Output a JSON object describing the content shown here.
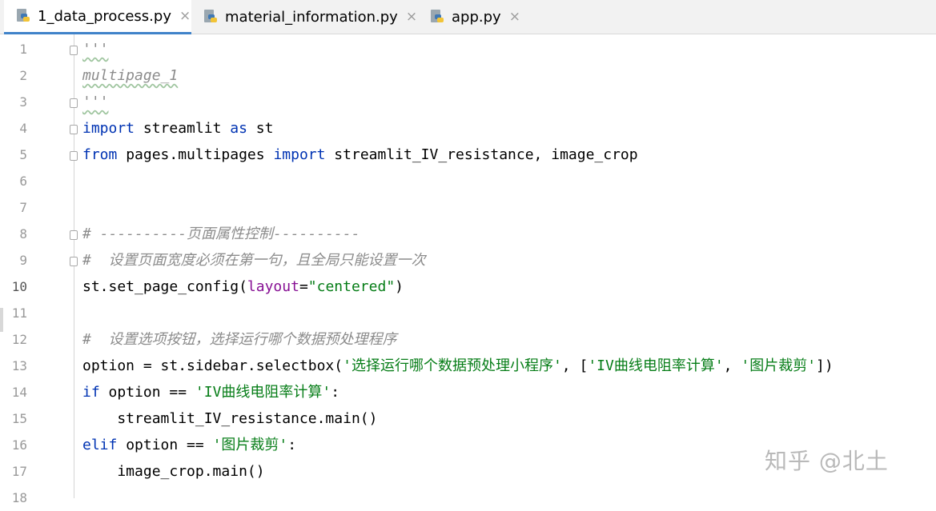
{
  "tabs": [
    {
      "label": "1_data_process.py",
      "icon": "python-file-icon",
      "active": true
    },
    {
      "label": "material_information.py",
      "icon": "python-file-icon",
      "active": false
    },
    {
      "label": "app.py",
      "icon": "python-file-icon",
      "active": false
    }
  ],
  "tab_close_glyph": "×",
  "line_numbers": [
    "1",
    "2",
    "3",
    "4",
    "5",
    "6",
    "7",
    "8",
    "9",
    "10",
    "11",
    "12",
    "13",
    "14",
    "15",
    "16",
    "17",
    "18"
  ],
  "current_line": "10",
  "code": {
    "l1": "'''",
    "l2": "multipage_1",
    "l3": "'''",
    "l4": {
      "k1": "import",
      "t1": " streamlit ",
      "k2": "as",
      "t2": " st"
    },
    "l5": {
      "k1": "from",
      "t1": " pages.multipages ",
      "k2": "import",
      "t2": " streamlit_IV_resistance, image_crop"
    },
    "l8": "# ----------页面属性控制----------",
    "l9": "#  设置页面宽度必须在第一句，且全局只能设置一次",
    "l10": {
      "t1": "st.set_page_config(",
      "p1": "layout",
      "t2": "=",
      "s1": "\"centered\"",
      "t3": ")"
    },
    "l12": "#  设置选项按钮，选择运行哪个数据预处理程序",
    "l13": {
      "t1": "option = st.sidebar.selectbox(",
      "s1": "'选择运行哪个数据预处理小程序'",
      "t2": ", [",
      "s2": "'IV曲线电阻率计算'",
      "t3": ", ",
      "s3": "'图片裁剪'",
      "t4": "])"
    },
    "l14": {
      "k1": "if",
      "t1": " option == ",
      "s1": "'IV曲线电阻率计算'",
      "t2": ":"
    },
    "l15": "    streamlit_IV_resistance.main()",
    "l16": {
      "k1": "elif",
      "t1": " option == ",
      "s1": "'图片裁剪'",
      "t2": ":"
    },
    "l17": "    image_crop.main()"
  },
  "watermark": "知乎 @北土",
  "colors": {
    "keyword": "#0033b3",
    "string": "#067d17",
    "comment": "#8c8c8c",
    "param": "#871094",
    "tab_underline": "#4083c9"
  }
}
